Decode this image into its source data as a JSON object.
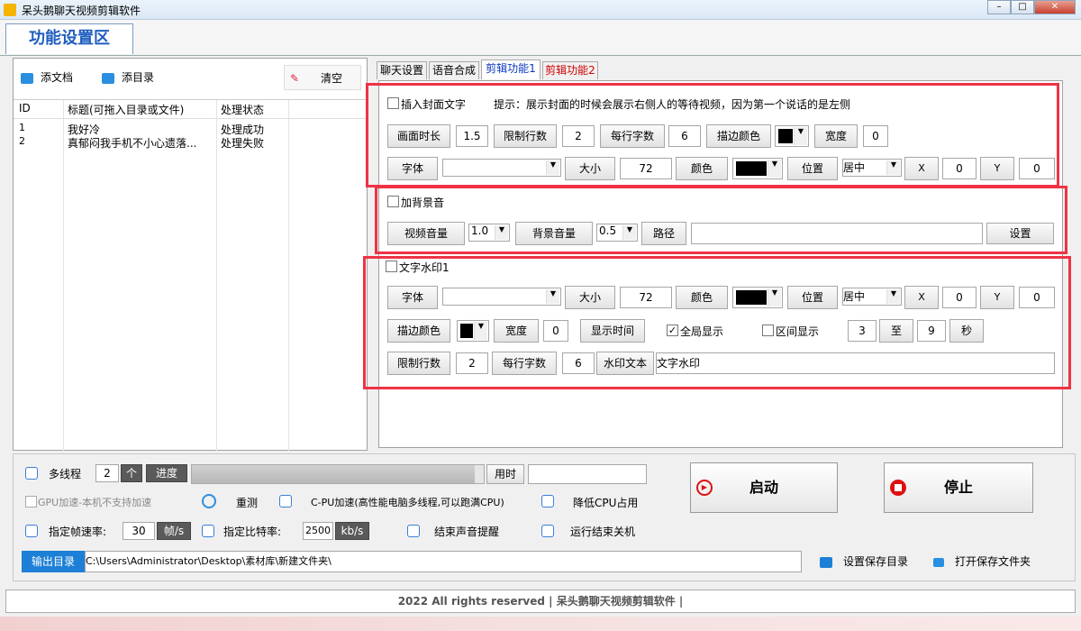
{
  "window": {
    "title": "呆头鹅聊天视频剪辑软件"
  },
  "main_tab": "功能设置区",
  "left_toolbar": {
    "add_doc": "添文档",
    "add_dir": "添目录",
    "clear": "清空"
  },
  "table": {
    "headers": [
      "ID",
      "标题(可拖入目录或文件)",
      "处理状态"
    ],
    "rows": [
      {
        "id": "1",
        "title": "我好冷",
        "status": "处理成功"
      },
      {
        "id": "2",
        "title": "真郁闷我手机不小心遗落...",
        "status": "处理失败"
      }
    ]
  },
  "tabs": [
    "聊天设置",
    "语音合成",
    "剪辑功能1",
    "剪辑功能2"
  ],
  "cover": {
    "checkbox": "插入封面文字",
    "hint": "提示：展示封面的时候会展示右侧人的等待视频，因为第一个说话的是左侧",
    "duration_label": "画面时长",
    "duration": "1.5",
    "limit_lines_label": "限制行数",
    "limit_lines": "2",
    "chars_label": "每行字数",
    "chars": "6",
    "stroke_color_label": "描边颜色",
    "width_label": "宽度",
    "width": "0",
    "font_label": "字体",
    "font_value": "",
    "size_label": "大小",
    "size": "72",
    "color_label": "颜色",
    "pos_label": "位置",
    "pos": "居中",
    "x_label": "X",
    "x": "0",
    "y_label": "Y",
    "y": "0"
  },
  "bgm": {
    "checkbox": "加背景音",
    "video_vol_label": "视频音量",
    "video_vol": "1.0",
    "bg_vol_label": "背景音量",
    "bg_vol": "0.5",
    "path_label": "路径",
    "path": "",
    "settings": "设置"
  },
  "watermark": {
    "checkbox": "文字水印1",
    "font_label": "字体",
    "font_value": "",
    "size_label": "大小",
    "size": "72",
    "color_label": "颜色",
    "pos_label": "位置",
    "pos": "居中",
    "x_label": "X",
    "x": "0",
    "y_label": "Y",
    "y": "0",
    "stroke_color_label": "描边颜色",
    "width_label": "宽度",
    "width": "0",
    "show_time": "显示时间",
    "global_show": "全局显示",
    "range_show": "区间显示",
    "range_start": "3",
    "to": "至",
    "range_end": "9",
    "sec": "秒",
    "limit_lines_label": "限制行数",
    "limit_lines": "2",
    "chars_label": "每行字数",
    "chars": "6",
    "text_label": "水印文本",
    "text": "文字水印"
  },
  "bottom": {
    "multithread": "多线程",
    "threads": "2",
    "unit_ge": "个",
    "progress_label": "进度",
    "progress": 0.97,
    "time_label": "用时",
    "time_value": "",
    "start": "启动",
    "stop": "停止",
    "gpu": "GPU加速-本机不支持加速",
    "recheck": "重测",
    "cpu": "C-PU加速(高性能电脑多线程,可以跑满CPU)",
    "lower_cpu": "降低CPU占用",
    "fps_label": "指定帧速率:",
    "fps": "30",
    "fps_unit": "帧/s",
    "bitrate_label": "指定比特率:",
    "bitrate": "2500",
    "bitrate_unit": "kb/s",
    "end_sound": "结束声音提醒",
    "shutdown": "运行结束关机",
    "output_label": "输出目录",
    "output_path": "C:\\Users\\Administrator\\Desktop\\素材库\\新建文件夹\\",
    "set_save": "设置保存目录",
    "open_save": "打开保存文件夹"
  },
  "footer": "2022 All rights reserved | 呆头鹅聊天视频剪辑软件 |"
}
